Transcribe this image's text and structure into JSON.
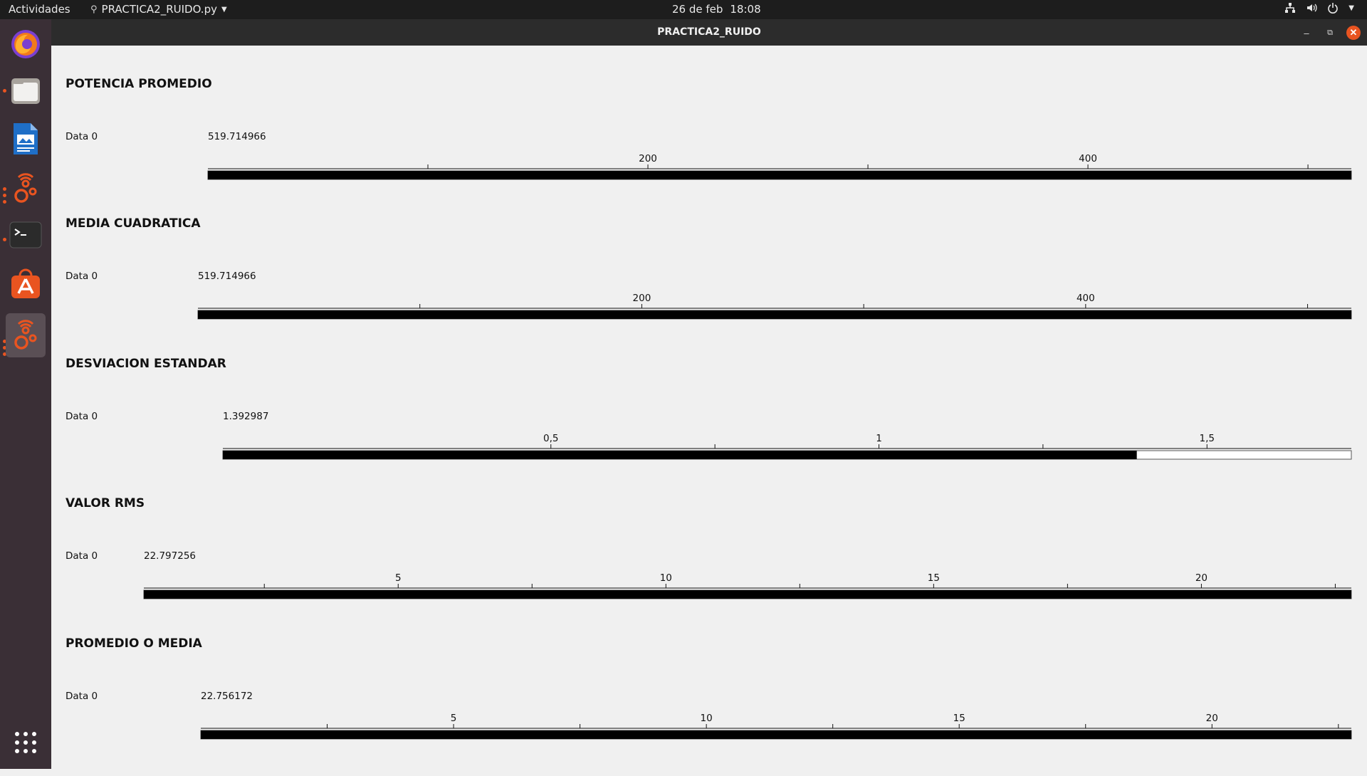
{
  "topbar": {
    "activities": "Actividades",
    "app_name": "PRACTICA2_RUIDO.py",
    "date": "26 de feb",
    "time": "18:08",
    "tray_icons": [
      "network-icon",
      "volume-icon",
      "power-icon",
      "chevron-down-icon"
    ]
  },
  "dock": {
    "items": [
      "firefox-icon",
      "files-icon",
      "writer-icon",
      "gnuradio-icon",
      "terminal-icon",
      "software-center-icon",
      "gnuradio-icon-active"
    ],
    "apps_grid_icon": "apps-grid-icon"
  },
  "window": {
    "title": "PRACTICA2_RUIDO",
    "accent": "#e95420"
  },
  "sections": [
    {
      "title": "POTENCIA PROMEDIO",
      "label": "Data 0",
      "value_text": "519.714966",
      "value": 519.714966,
      "min": 0,
      "max": 519.714966,
      "major_ticks": [
        200,
        400
      ],
      "major_tick_labels": [
        "200",
        "400"
      ],
      "minor_ticks": [
        100,
        300,
        500
      ]
    },
    {
      "title": "MEDIA CUADRATICA",
      "label": "Data 0",
      "value_text": "519.714966",
      "value": 519.714966,
      "min": 0,
      "max": 519.714966,
      "major_ticks": [
        200,
        400
      ],
      "major_tick_labels": [
        "200",
        "400"
      ],
      "minor_ticks": [
        100,
        300,
        500
      ]
    },
    {
      "title": "DESVIACION ESTANDAR",
      "label": "Data 0",
      "value_text": "1.392987",
      "value": 1.392987,
      "min": 0,
      "max": 1.72,
      "major_ticks": [
        0.5,
        1,
        1.5
      ],
      "major_tick_labels": [
        "0,5",
        "1",
        "1,5"
      ],
      "minor_ticks": [
        0.75,
        1.25
      ]
    },
    {
      "title": "VALOR RMS",
      "label": "Data 0",
      "value_text": "22.797256",
      "value": 22.797256,
      "min": 0.25,
      "max": 22.8,
      "major_ticks": [
        5,
        10,
        15,
        20
      ],
      "major_tick_labels": [
        "5",
        "10",
        "15",
        "20"
      ],
      "minor_ticks": [
        2.5,
        7.5,
        12.5,
        17.5,
        22.5
      ]
    },
    {
      "title": "PROMEDIO O MEDIA",
      "label": "Data 0",
      "value_text": "22.756172",
      "value": 22.756172,
      "min": 0,
      "max": 22.756172,
      "major_ticks": [
        5,
        10,
        15,
        20
      ],
      "major_tick_labels": [
        "5",
        "10",
        "15",
        "20"
      ],
      "minor_ticks": [
        2.5,
        7.5,
        12.5,
        17.5,
        22.5
      ]
    }
  ]
}
